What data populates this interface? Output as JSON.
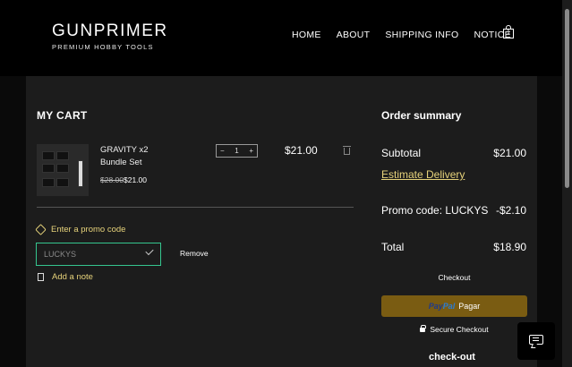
{
  "header": {
    "brand": "GUNPRIMER",
    "tagline": "PREMIUM HOBBY TOOLS",
    "nav": [
      "HOME",
      "ABOUT",
      "SHIPPING INFO",
      "NOTICE"
    ],
    "cart_count": "1"
  },
  "cart": {
    "title": "MY CART",
    "item": {
      "name": "GRAVITY x2 Bundle Set",
      "old_price": "$28.00",
      "new_price": "$21.00",
      "quantity": "1",
      "line_total": "$21.00"
    },
    "promo_link": "Enter a promo code",
    "promo_value": "LUCKYS",
    "remove": "Remove",
    "note_link": "Add a note"
  },
  "summary": {
    "title": "Order summary",
    "subtotal_label": "Subtotal",
    "subtotal_value": "$21.00",
    "estimate": "Estimate Delivery",
    "promo_label": "Promo code: LUCKYS",
    "promo_value": "-$2.10",
    "total_label": "Total",
    "total_value": "$18.90",
    "checkout": "Checkout",
    "paypal_1": "Pay",
    "paypal_2": "Pal",
    "paypal_action": "Pagar",
    "secure": "Secure Checkout"
  },
  "bottom_label": "check-out",
  "colors": {
    "accent": "#e6d27a",
    "input_border": "#35c68f",
    "paypal_button": "#7a5c12"
  }
}
